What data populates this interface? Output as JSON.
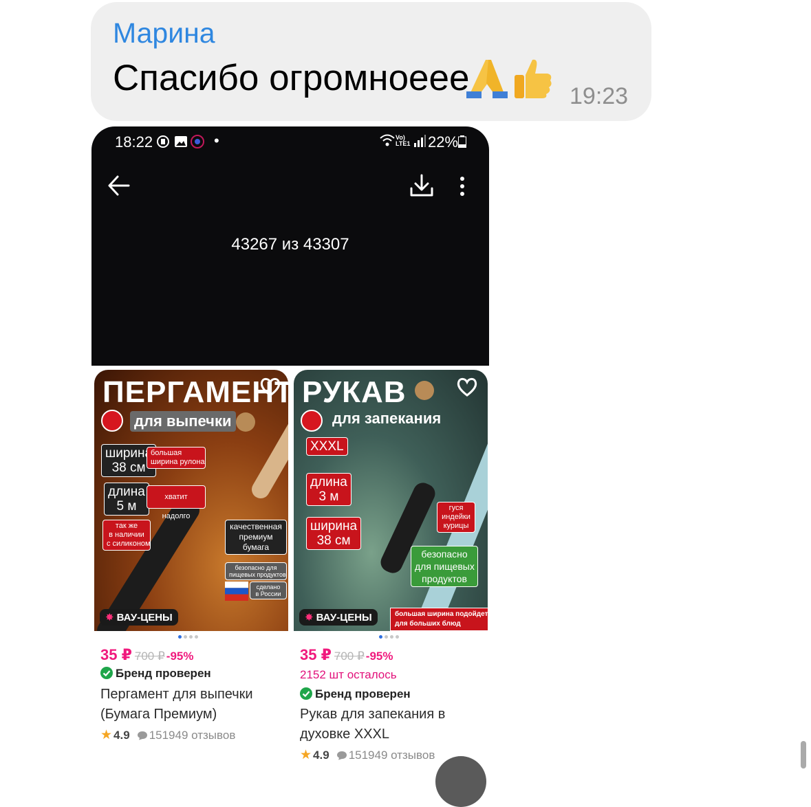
{
  "message": {
    "sender": "Марина",
    "text": "Спасибо огромноеее",
    "emojis": [
      "folded-hands",
      "thumbs-up"
    ],
    "time": "19:23"
  },
  "screenshot": {
    "status_bar": {
      "time": "18:22",
      "network": "Vo)\nLTE1",
      "battery": "22%"
    },
    "counter": "43267 из 43307"
  },
  "products": [
    {
      "image": {
        "title": "ПЕРГАМЕНТ",
        "subtitle": "для выпечки",
        "tags": [
          "ширина\n38 см",
          "большая\nширина рулона",
          "длина\n5 м",
          "хватит надолго",
          "так же\nв наличии\nс силиконом",
          "качественная\nпремиум\nбумага",
          "безопасно для\nпищевых продуктов",
          "сделано\nв России"
        ],
        "badge": "ВАУ-ЦЕНЫ"
      },
      "price": "35 ₽",
      "old_price": "700 ₽",
      "discount": "-95%",
      "brand_check": "Бренд проверен",
      "name": "Пергамент для выпечки (Бумага Премиум)",
      "rating": "4.9",
      "reviews": "151949 отзывов"
    },
    {
      "image": {
        "title": "РУКАВ",
        "subtitle": "для запекания",
        "tags": [
          "XXXL",
          "длина\n3 м",
          "ширина\n38 см",
          "гуся\nиндейки\nкурицы",
          "безопасно\nдля пищевых\nпродуктов",
          "большая ширина подойдет\nдля больших блюд"
        ],
        "badge": "ВАУ-ЦЕНЫ"
      },
      "price": "35 ₽",
      "old_price": "700 ₽",
      "discount": "-95%",
      "remaining": "2152 шт осталось",
      "brand_check": "Бренд проверен",
      "name": "Рукав для запекания в духовке XXXL",
      "rating": "4.9",
      "reviews": "151949 отзывов"
    }
  ],
  "colors": {
    "sender": "#2f87e0",
    "bubble": "#efefef",
    "price": "#f0197d",
    "check": "#1fa64a",
    "star": "#f5a623"
  }
}
